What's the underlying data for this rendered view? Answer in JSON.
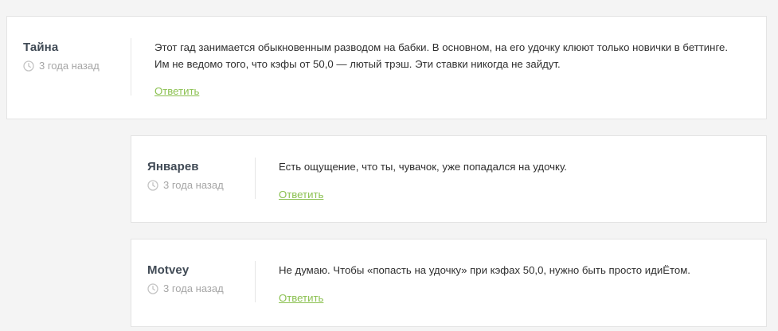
{
  "comments": [
    {
      "author": "Тайна",
      "time": "3 года назад",
      "text": "Этот гад занимается обыкновенным разводом на бабки. В основном, на его удочку клюют только новички в беттинге. Им не ведомо того, что кэфы от 50,0 — лютый трэш. Эти ставки никогда не зайдут.",
      "reply_label": "Ответить"
    },
    {
      "author": "Январев",
      "time": "3 года назад",
      "text": "Есть ощущение, что ты, чувачок, уже попадался на удочку.",
      "reply_label": "Ответить"
    },
    {
      "author": "Motvey",
      "time": "3 года назад",
      "text": "Не думаю. Чтобы «попасть на удочку» при кэфах 50,0, нужно быть просто идиЁтом.",
      "reply_label": "Ответить"
    }
  ],
  "colors": {
    "accent": "#8cc152",
    "author": "#404a55",
    "muted": "#a6a6a6",
    "background": "#f4f4f4"
  },
  "icons": {
    "time": "clock-icon"
  }
}
